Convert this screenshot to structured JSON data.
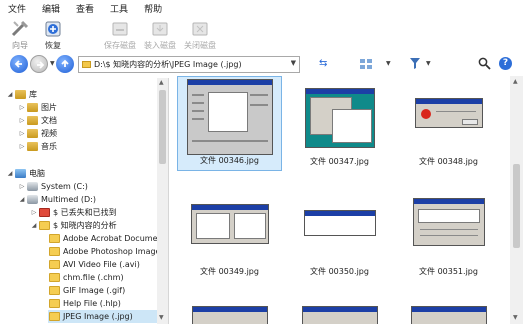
{
  "menu": [
    "文件",
    "编辑",
    "查看",
    "工具",
    "帮助"
  ],
  "toolbar": {
    "wizard": "向导",
    "restore": "恢复",
    "save_disk": "保存磁盘",
    "load_disk": "装入磁盘",
    "close_disk": "关闭磁盘"
  },
  "address": {
    "path": "D:\\$ 知晓内容的分析\\JPEG Image (.jpg)"
  },
  "tree": {
    "library": "库",
    "pictures": "图片",
    "documents": "文档",
    "videos": "视频",
    "music": "音乐",
    "computer": "电脑",
    "system_c": "System (C:)",
    "multimed_d": "Multimed (D:)",
    "lost_found": "$ 已丢失和已找到",
    "content_analysis": "$ 知晓内容的分析",
    "acrobat": "Adobe Acrobat Documer",
    "photoshop": "Adobe Photoshop Image",
    "avi": "AVI Video File (.avi)",
    "chm": "chm.file (.chm)",
    "gif": "GIF Image (.gif)",
    "hlp": "Help File (.hlp)",
    "jpeg": "JPEG Image (.jpg)"
  },
  "files": [
    "文件 00346.jpg",
    "文件 00347.jpg",
    "文件 00348.jpg",
    "文件 00349.jpg",
    "文件 00350.jpg",
    "文件 00351.jpg"
  ],
  "colors": {
    "selection": "#d6ebfb",
    "accent": "#2d6ed8"
  }
}
